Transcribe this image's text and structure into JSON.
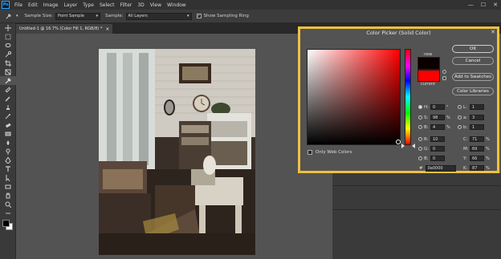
{
  "app": {
    "logo": "Ps"
  },
  "menu": [
    "File",
    "Edit",
    "Image",
    "Layer",
    "Type",
    "Select",
    "Filter",
    "3D",
    "View",
    "Window"
  ],
  "window_controls": {
    "minimize": "—",
    "maximize": "☐",
    "close": "✕"
  },
  "options": {
    "sample_size_label": "Sample Size:",
    "sample_size_value": "Point Sample",
    "sample_label": "Sample:",
    "sample_value": "All Layers",
    "show_ring_label": "Show Sampling Ring",
    "show_ring_checked": true
  },
  "document_tab": {
    "title": "Untitled-1 @ 16.7% (Color Fill 1, RGB/8) *",
    "close": "×"
  },
  "dialog": {
    "title": "Color Picker (Solid Color)",
    "close": "✕",
    "new_label": "new",
    "current_label": "current",
    "new_color": "#0b0000",
    "current_color": "#ff0000",
    "buttons": {
      "ok": "OK",
      "cancel": "Cancel",
      "add_swatches": "Add to Swatches",
      "color_libraries": "Color Libraries"
    },
    "only_web_colors": "Only Web Colors",
    "hex_label": "#",
    "hex_value": "0a0000",
    "hsb": [
      {
        "label": "H:",
        "value": "0",
        "unit": "°",
        "selected": true
      },
      {
        "label": "S:",
        "value": "98",
        "unit": "%",
        "selected": false
      },
      {
        "label": "B:",
        "value": "4",
        "unit": "%",
        "selected": false
      }
    ],
    "rgb": [
      {
        "label": "R:",
        "value": "10",
        "selected": false
      },
      {
        "label": "G:",
        "value": "0",
        "selected": false
      },
      {
        "label": "B:",
        "value": "0",
        "selected": false
      }
    ],
    "lab": [
      {
        "label": "L:",
        "value": "1"
      },
      {
        "label": "a:",
        "value": "3"
      },
      {
        "label": "b:",
        "value": "1"
      }
    ],
    "cmyk": [
      {
        "label": "C:",
        "value": "71",
        "unit": "%"
      },
      {
        "label": "M:",
        "value": "69",
        "unit": "%"
      },
      {
        "label": "Y:",
        "value": "66",
        "unit": "%"
      },
      {
        "label": "K:",
        "value": "87",
        "unit": "%"
      }
    ]
  }
}
